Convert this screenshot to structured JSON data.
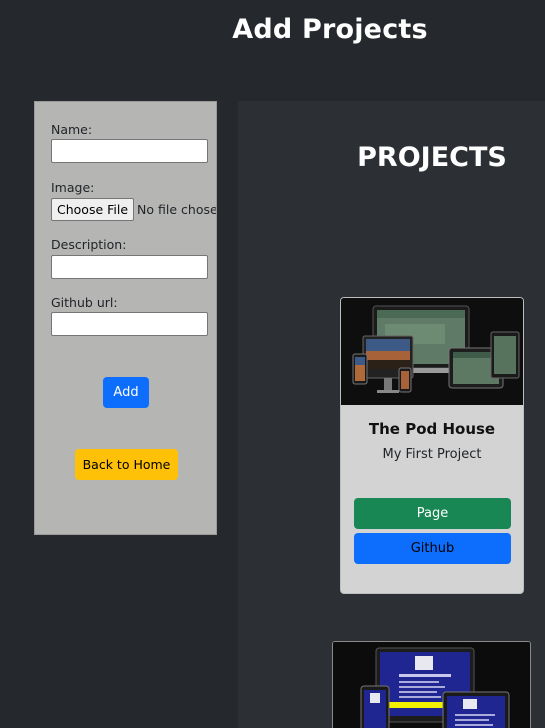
{
  "header": {
    "title": "Add Projects"
  },
  "form": {
    "name_label": "Name:",
    "name_value": "",
    "image_label": "Image:",
    "file_button_label": "Choose File",
    "file_status": "No file chosen",
    "description_label": "Description:",
    "description_value": "",
    "github_label": "Github url:",
    "github_value": "",
    "add_label": "Add",
    "home_label": "Back to Home"
  },
  "projects": {
    "heading": "PROJECTS",
    "items": [
      {
        "title": "The Pod House",
        "description": "My First Project",
        "page_label": "Page",
        "github_label": "Github",
        "image_icon": "devices-mockup-image"
      },
      {
        "image_icon": "devices-mockup-image"
      }
    ]
  },
  "colors": {
    "background": "#25282d",
    "projects_panel": "#2c2f34",
    "form_panel": "#b5b5b3",
    "card": "#d3d3d3",
    "primary": "#0d6efd",
    "success": "#198754",
    "warning": "#ffc107"
  }
}
